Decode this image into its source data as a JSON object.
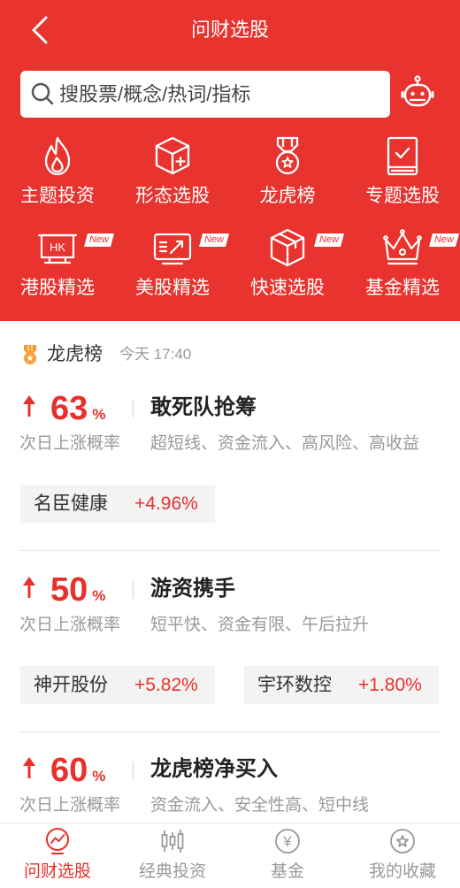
{
  "colors": {
    "header_bg": "#e8332f",
    "up": "#e8302c",
    "muted": "#999999",
    "chip_bg": "#f3f3f3",
    "active_tab": "#e8302c",
    "inactive_tab": "#9a9a9a",
    "medal": "#f39a2e"
  },
  "header": {
    "title": "问财选股",
    "back_icon": "back-arrow-icon",
    "assistant_icon": "robot-icon"
  },
  "search": {
    "placeholder": "搜股票/概念/热词/指标",
    "icon": "search-icon"
  },
  "categories": [
    {
      "label": "主题投资",
      "icon": "flame-icon"
    },
    {
      "label": "形态选股",
      "icon": "cube-plus-icon"
    },
    {
      "label": "龙虎榜",
      "icon": "medal-icon"
    },
    {
      "label": "专题选股",
      "icon": "book-check-icon"
    },
    {
      "label": "港股精选",
      "icon": "hk-sign-icon",
      "icon_text": "HK",
      "badge": "New"
    },
    {
      "label": "美股精选",
      "icon": "chart-screen-icon",
      "badge": "New"
    },
    {
      "label": "快速选股",
      "icon": "box-icon",
      "badge": "New"
    },
    {
      "label": "基金精选",
      "icon": "crown-icon",
      "badge": "New"
    }
  ],
  "section": {
    "title": "龙虎榜",
    "time": "今天 17:40",
    "icon": "medal-icon"
  },
  "strategies": [
    {
      "probability": 63,
      "unit": "%",
      "name": "敢死队抢筹",
      "probability_label": "次日上涨概率",
      "tags": "超短线、资金流入、高风险、高收益",
      "stocks": [
        {
          "name": "名臣健康",
          "change": "+4.96%"
        }
      ]
    },
    {
      "probability": 50,
      "unit": "%",
      "name": "游资携手",
      "probability_label": "次日上涨概率",
      "tags": "短平快、资金有限、午后拉升",
      "stocks": [
        {
          "name": "神开股份",
          "change": "+5.82%"
        },
        {
          "name": "宇环数控",
          "change": "+1.80%"
        }
      ]
    },
    {
      "probability": 60,
      "unit": "%",
      "name": "龙虎榜净买入",
      "probability_label": "次日上涨概率",
      "tags": "资金流入、安全性高、短中线",
      "stocks": []
    }
  ],
  "tabs": [
    {
      "label": "问财选股",
      "icon": "wencai-chart-icon",
      "active": true
    },
    {
      "label": "经典投资",
      "icon": "candlestick-icon",
      "active": false
    },
    {
      "label": "基金",
      "icon": "yen-coin-icon",
      "icon_text": "¥",
      "active": false
    },
    {
      "label": "我的收藏",
      "icon": "star-circle-icon",
      "active": false
    }
  ]
}
